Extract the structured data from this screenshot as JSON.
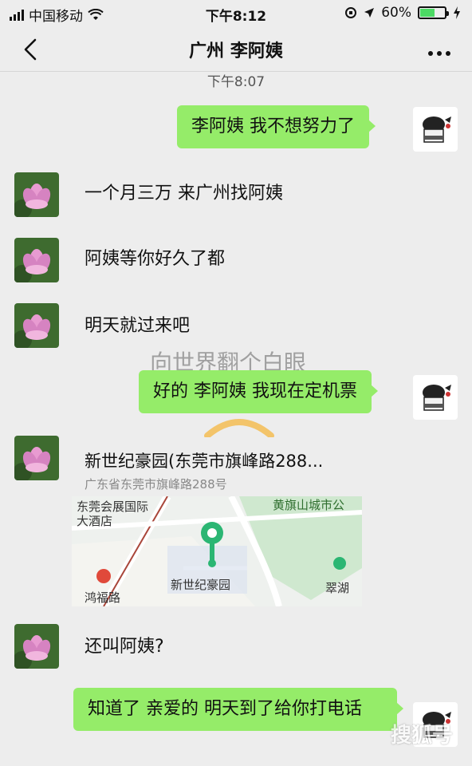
{
  "status_bar": {
    "carrier": "中国移动",
    "time": "下午8:12",
    "battery": "60%",
    "battery_level": 0.6
  },
  "header": {
    "title": "广州 李阿姨",
    "back_icon": "chevron-left-icon",
    "more_icon": "more-dots-icon"
  },
  "chat": {
    "timestamp": "下午8:07",
    "overlay_caption": "向世界翻个白眼",
    "messages": [
      {
        "side": "right",
        "text": "李阿姨  我不想努力了"
      },
      {
        "side": "left",
        "text": "一个月三万  来广州找阿姨"
      },
      {
        "side": "left",
        "text": "阿姨等你好久了都"
      },
      {
        "side": "left",
        "text": "明天就过来吧"
      },
      {
        "side": "right",
        "text": "好的  李阿姨 我现在定机票"
      },
      {
        "side": "left",
        "text": "还叫阿姨?"
      },
      {
        "side": "right",
        "text": "知道了  亲爱的  明天到了给你打电话"
      }
    ],
    "location": {
      "title": "新世纪豪园(东莞市旗峰路288...",
      "address": "广东省东莞市旗峰路288号",
      "map_labels": {
        "hotel": "东莞会展国际大酒店",
        "road": "鸿福路",
        "pin_label": "新世纪豪园",
        "lake": "翠湖",
        "park": "黄旗山城市公"
      }
    }
  },
  "watermark": "搜狐号"
}
